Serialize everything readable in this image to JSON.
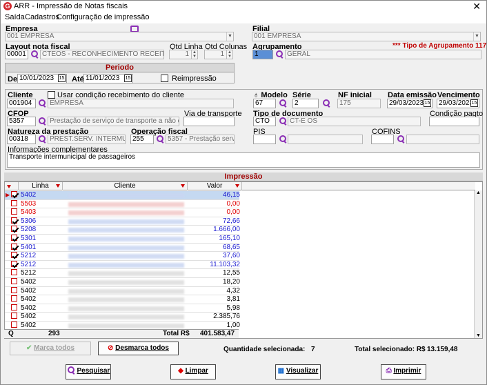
{
  "window": {
    "title": "ARR - Impressão de Notas fiscais",
    "close": "✕"
  },
  "menu": [
    "Saída",
    "Cadastros",
    "Configuração de impressão"
  ],
  "empresa": {
    "label": "Empresa",
    "value": "001 EMPRESA"
  },
  "filial": {
    "label": "Filial",
    "value": "001 EMPRESA"
  },
  "layout": {
    "label": "Layout nota fiscal",
    "code": "00001",
    "desc": "CTEOS - RECONHECIMENTO RECEITA EMTU"
  },
  "qtd_linha": {
    "label": "Qtd Linha",
    "value": "1"
  },
  "qtd_colunas": {
    "label": "Qtd Colunas",
    "value": "1"
  },
  "agrupamento": {
    "label": "Agrupamento",
    "code": "1",
    "desc": "GERAL",
    "tipo": "*** Tipo de Agrupamento 117 ***"
  },
  "periodo": {
    "title": "Periodo",
    "de_label": "De",
    "de": "10/01/2023",
    "ate_label": "Até",
    "ate": "11/01/2023",
    "reimpressao": "Reimpressão"
  },
  "cliente": {
    "label": "Cliente",
    "code": "001904",
    "name": "EMPRESA",
    "usar_cond": "Usar condição recebimento do cliente"
  },
  "modelo": {
    "label": "Modelo",
    "value": "67"
  },
  "serie": {
    "label": "Série",
    "value": "2"
  },
  "nf_inicial": {
    "label": "NF inicial",
    "value": "175"
  },
  "data_emissao": {
    "label": "Data emissão",
    "value": "29/03/2023"
  },
  "vencimento": {
    "label": "Vencimento",
    "value": "29/03/2023"
  },
  "cfop": {
    "label": "CFOP",
    "code": "5357",
    "desc": "Prestação de serviço de transporte a não contribuinte"
  },
  "via_transporte": {
    "label": "Via de transporte"
  },
  "tipo_doc": {
    "label": "Tipo de documento",
    "code": "CTO",
    "desc": "CT-E OS"
  },
  "cond_pagto": {
    "label": "Condição pagto"
  },
  "natureza": {
    "label": "Natureza da prestação",
    "code": "00318",
    "desc": "PREST.SERV. INTERMUNICIPAL"
  },
  "operacao": {
    "label": "Operação fiscal",
    "code": "255",
    "desc": "5357 - Prestação serviço trar"
  },
  "pis": {
    "label": "PIS"
  },
  "cofins": {
    "label": "COFINS"
  },
  "info": {
    "label": "Informações complementares",
    "value": "Transporte intermunicipal de passageiros"
  },
  "impressao": {
    "title": "Impressão",
    "col_linha": "Linha",
    "col_cliente": "Cliente",
    "col_valor": "Valor"
  },
  "rows": [
    {
      "linha": "5402",
      "valor": "46,15",
      "checked": true,
      "color": "#1a1ad0",
      "blur": "blue",
      "sel": true
    },
    {
      "linha": "5503",
      "valor": "0,00",
      "checked": false,
      "color": "#e00000",
      "blur": "red"
    },
    {
      "linha": "5403",
      "valor": "0,00",
      "checked": false,
      "color": "#e00000",
      "blur": "red"
    },
    {
      "linha": "5306",
      "valor": "72,66",
      "checked": true,
      "color": "#1a1ad0",
      "blur": "blue"
    },
    {
      "linha": "5208",
      "valor": "1.666,00",
      "checked": true,
      "color": "#1a1ad0",
      "blur": "blue"
    },
    {
      "linha": "5301",
      "valor": "165,10",
      "checked": true,
      "color": "#1a1ad0",
      "blur": "blue"
    },
    {
      "linha": "5401",
      "valor": "68,65",
      "checked": true,
      "color": "#1a1ad0",
      "blur": "blue"
    },
    {
      "linha": "5212",
      "valor": "37,60",
      "checked": true,
      "color": "#1a1ad0",
      "blur": "blue"
    },
    {
      "linha": "5212",
      "valor": "11.103,32",
      "checked": true,
      "color": "#1a1ad0",
      "blur": "blue"
    },
    {
      "linha": "5212",
      "valor": "12,55",
      "checked": false,
      "color": "#000000",
      "blur": "grey"
    },
    {
      "linha": "5402",
      "valor": "18,20",
      "checked": false,
      "color": "#000000",
      "blur": "grey"
    },
    {
      "linha": "5402",
      "valor": "4,32",
      "checked": false,
      "color": "#000000",
      "blur": "grey"
    },
    {
      "linha": "5402",
      "valor": "3,81",
      "checked": false,
      "color": "#000000",
      "blur": "grey"
    },
    {
      "linha": "5402",
      "valor": "5,98",
      "checked": false,
      "color": "#000000",
      "blur": "grey"
    },
    {
      "linha": "5402",
      "valor": "2.385,76",
      "checked": false,
      "color": "#000000",
      "blur": "grey"
    },
    {
      "linha": "5402",
      "valor": "1,00",
      "checked": false,
      "color": "#000000",
      "blur": "grey"
    }
  ],
  "footer": {
    "q_label": "Q",
    "q_value": "293",
    "total_label": "Total R$",
    "total_value": "401.583,47"
  },
  "actions": {
    "marca_todos": "Marca todos",
    "desmarca_todos": "Desmarca todos",
    "qtd_sel_label": "Quantidade selecionada:",
    "qtd_sel_value": "7",
    "total_sel_label": "Total selecionado: R$",
    "total_sel_value": "13.159,48"
  },
  "buttons": {
    "pesquisar": "Pesquisar",
    "limpar": "Limpar",
    "visualizar": "Visualizar",
    "imprimir": "Imprimir"
  }
}
